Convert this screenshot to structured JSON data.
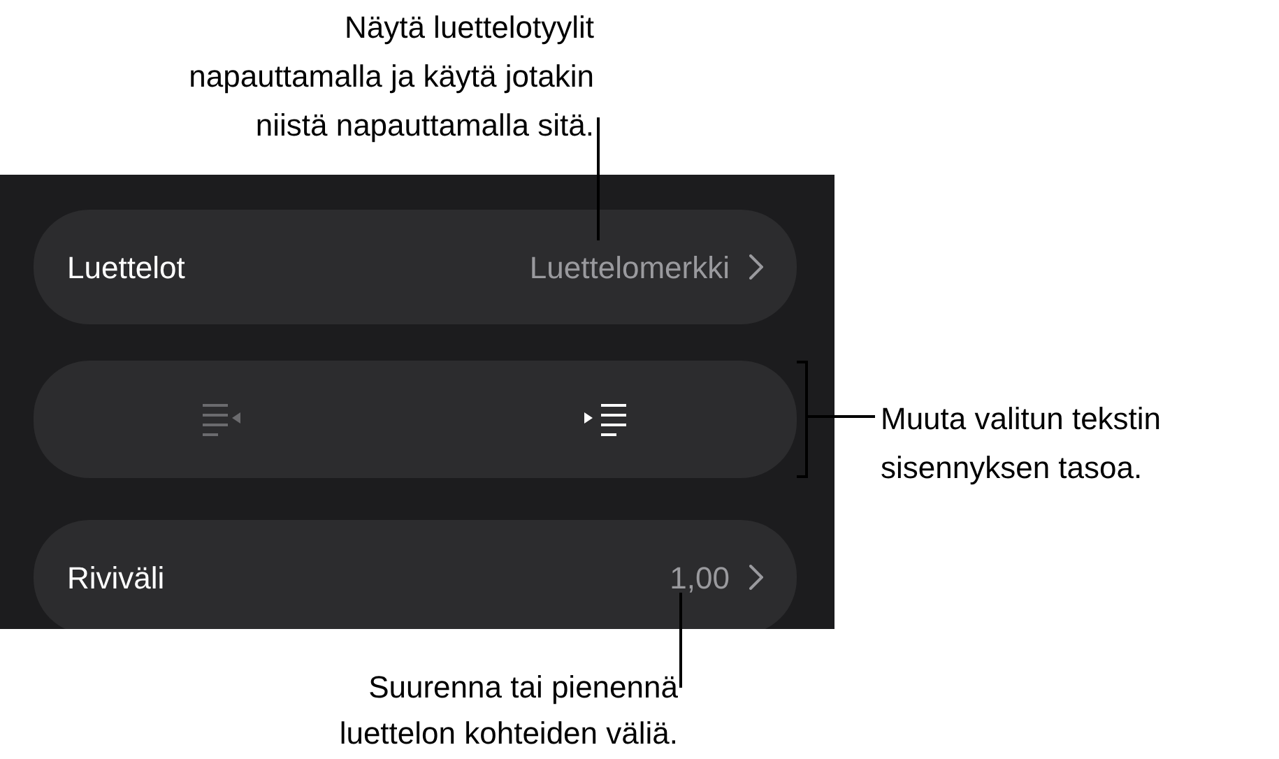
{
  "panel": {
    "rows": [
      {
        "kind": "nav",
        "label": "Luettelot",
        "value": "Luettelomerkki"
      },
      {
        "kind": "indent",
        "buttons": [
          {
            "kind": "decrease",
            "disabled": true
          },
          {
            "kind": "increase",
            "disabled": false
          }
        ]
      },
      {
        "kind": "nav",
        "label": "Riviväli",
        "value": "1,00"
      }
    ]
  },
  "callouts": [
    {
      "lines": [
        "Näytä luettelotyylit",
        "napauttamalla ja käytä jotakin",
        "niistä napauttamalla sitä."
      ]
    },
    {
      "lines": [
        "Muuta valitun tekstin",
        "sisennyksen tasoa."
      ]
    },
    {
      "lines": [
        "Suurenna tai pienennä",
        "luettelon kohteiden väliä."
      ]
    }
  ]
}
